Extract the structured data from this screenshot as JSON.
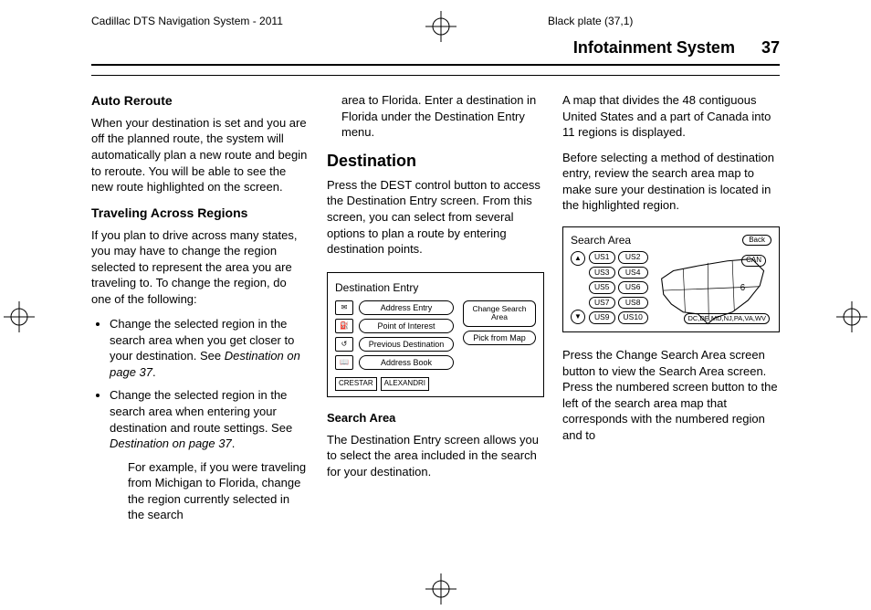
{
  "header": {
    "left": "Cadillac DTS Navigation System - 2011",
    "right": "Black plate (37,1)"
  },
  "running_head": {
    "title": "Infotainment System",
    "page": "37"
  },
  "col1": {
    "h_auto": "Auto Reroute",
    "p_auto": "When your destination is set and you are off the planned route, the system will automatically plan a new route and begin to reroute. You will be able to see the new route highlighted on the screen.",
    "h_trav": "Traveling Across Regions",
    "p_trav": "If you plan to drive across many states, you may have to change the region selected to represent the area you are traveling to. To change the region, do one of the following:",
    "li1a": "Change the selected region in the search area when you get closer to your destination. See ",
    "li1b": "Destination on page 37",
    "li1c": ".",
    "li2a": "Change the selected region in the search area when entering your destination and route settings. See ",
    "li2b": "Destination on page 37",
    "li2c": ".",
    "sub": "For example, if you were traveling from Michigan to Florida, change the region currently selected in the search"
  },
  "col2": {
    "p_cont": "area to Florida. Enter a destination in Florida under the Destination Entry menu.",
    "h_dest": "Destination",
    "p_dest": "Press the DEST control button to access the Destination Entry screen. From this screen, you can select from several options to plan a route by entering destination points.",
    "fig": {
      "title": "Destination Entry",
      "btn_addr": "Address Entry",
      "btn_poi": "Point of Interest",
      "btn_prev": "Previous Destination",
      "btn_book": "Address Book",
      "btn_change": "Change Search Area",
      "btn_pick": "Pick from Map",
      "mini1": "CRESTAR",
      "mini2": "ALEXANDRI"
    },
    "h_sa": "Search Area",
    "p_sa": "The Destination Entry screen allows you to select the area included in the search for your destination."
  },
  "col3": {
    "p1": "A map that divides the 48 contiguous United States and a part of Canada into 11 regions is displayed.",
    "p2": "Before selecting a method of destination entry, review the search area map to make sure your destination is located in the highlighted region.",
    "fig": {
      "title": "Search Area",
      "back": "Back",
      "us1": "US1",
      "us2": "US2",
      "us3": "US3",
      "us4": "US4",
      "us5": "US5",
      "us6": "US6",
      "us7": "US7",
      "us8": "US8",
      "us9": "US9",
      "us10": "US10",
      "can": "CAN",
      "states": "DC,DE,MD,NJ,PA,VA,WV"
    },
    "p3": "Press the Change Search Area screen button to view the Search Area screen. Press the numbered screen button to the left of the search area map that corresponds with the numbered region and to"
  }
}
